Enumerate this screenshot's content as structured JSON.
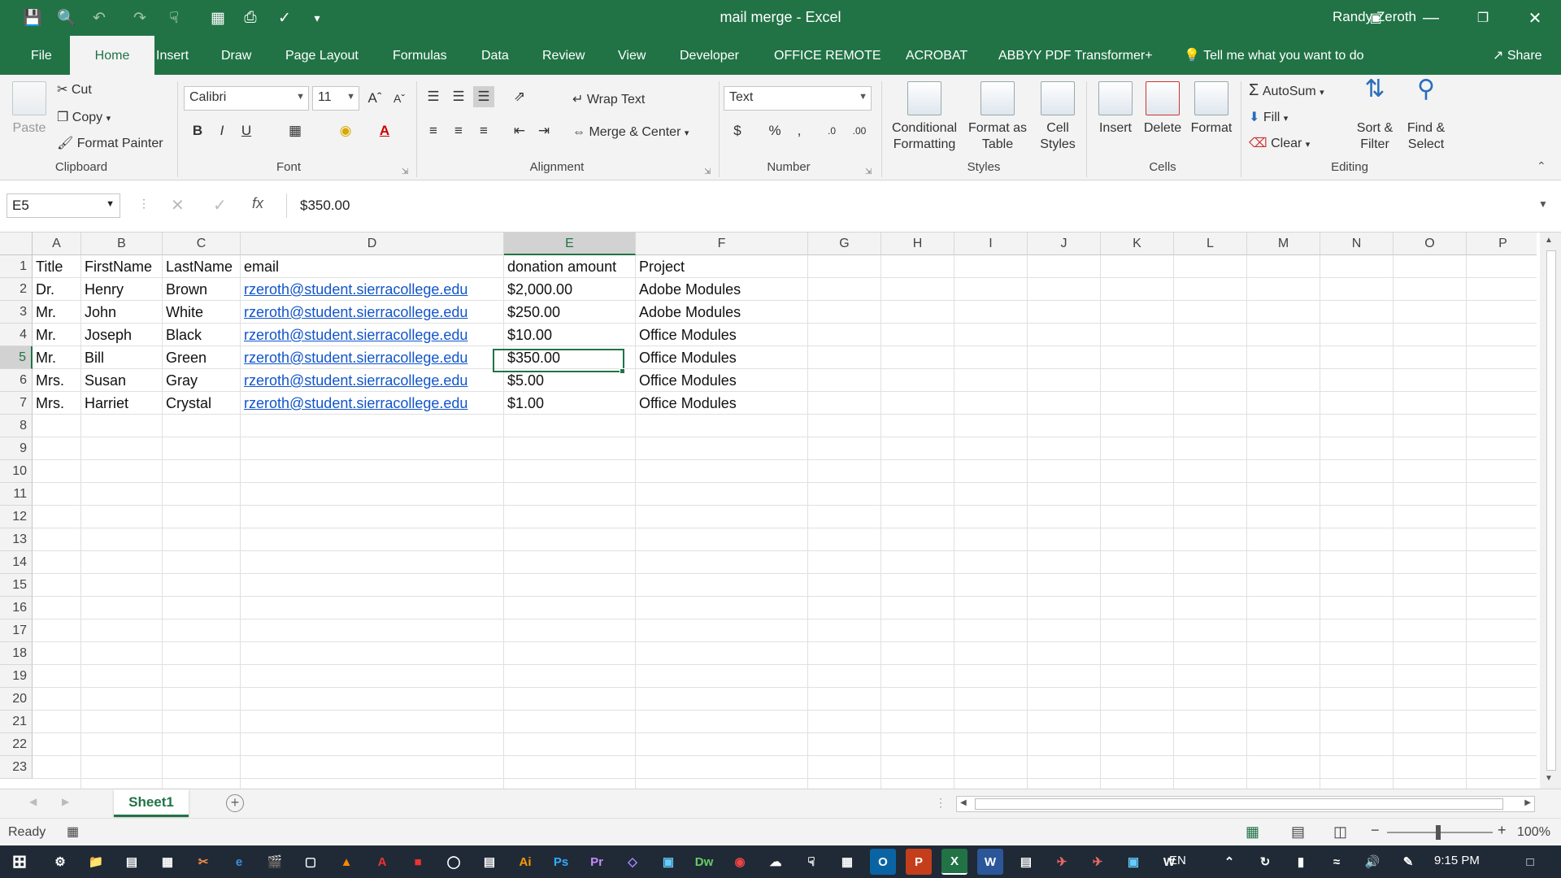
{
  "window": {
    "title": "mail merge  -  Excel",
    "user": "Randy Zeroth"
  },
  "tabs": [
    "File",
    "Home",
    "Insert",
    "Draw",
    "Page Layout",
    "Formulas",
    "Data",
    "Review",
    "View",
    "Developer",
    "OFFICE REMOTE",
    "ACROBAT",
    "ABBYY PDF Transformer+"
  ],
  "active_tab": "Home",
  "tell_me": "Tell me what you want to do",
  "share": "Share",
  "clipboard": {
    "paste": "Paste",
    "cut": "Cut",
    "copy": "Copy",
    "format_painter": "Format Painter",
    "label": "Clipboard"
  },
  "font": {
    "name": "Calibri",
    "size": "11",
    "bold": "B",
    "italic": "I",
    "underline": "U",
    "label": "Font"
  },
  "alignment": {
    "wrap_text": "Wrap Text",
    "merge_center": "Merge & Center",
    "label": "Alignment"
  },
  "number": {
    "format": "Text",
    "currency": "$",
    "percent": "%",
    "comma": ",",
    "label": "Number"
  },
  "styles": {
    "conditional": "Conditional",
    "conditional2": "Formatting",
    "format_as": "Format as",
    "table": "Table",
    "cell": "Cell",
    "styles": "Styles",
    "label": "Styles"
  },
  "cells": {
    "insert": "Insert",
    "delete": "Delete",
    "format": "Format",
    "label": "Cells"
  },
  "editing": {
    "autosum": "AutoSum",
    "fill": "Fill",
    "clear": "Clear",
    "sort": "Sort &",
    "filter": "Filter",
    "find": "Find &",
    "select": "Select",
    "label": "Editing"
  },
  "formula_bar": {
    "name_box": "E5",
    "fx": "fx",
    "content": "$350.00"
  },
  "columns": [
    "A",
    "B",
    "C",
    "D",
    "E",
    "F",
    "G",
    "H",
    "I",
    "J",
    "K",
    "L",
    "M",
    "N",
    "O",
    "P"
  ],
  "selected_column": "E",
  "selected_row": 5,
  "row_numbers": [
    "1",
    "2",
    "3",
    "4",
    "5",
    "6",
    "7",
    "8",
    "9",
    "10",
    "11",
    "12",
    "13",
    "14",
    "15",
    "16",
    "17",
    "18",
    "19",
    "20",
    "21",
    "22",
    "23"
  ],
  "table": {
    "headers": [
      "Title",
      "FirstName",
      "LastName",
      "email",
      "donation amount",
      "Project"
    ],
    "rows": [
      [
        "Dr.",
        "Henry",
        "Brown",
        "rzeroth@student.sierracollege.edu",
        "$2,000.00",
        "Adobe Modules"
      ],
      [
        "Mr.",
        "John",
        "White",
        "rzeroth@student.sierracollege.edu",
        "$250.00",
        "Adobe Modules"
      ],
      [
        "Mr.",
        "Joseph",
        "Black",
        "rzeroth@student.sierracollege.edu",
        "$10.00",
        "Office Modules"
      ],
      [
        "Mr.",
        "Bill",
        "Green",
        "rzeroth@student.sierracollege.edu",
        "$350.00",
        "Office Modules"
      ],
      [
        "Mrs.",
        "Susan",
        "Gray",
        "rzeroth@student.sierracollege.edu",
        "$5.00",
        "Office Modules"
      ],
      [
        "Mrs.",
        "Harriet",
        "Crystal",
        "rzeroth@student.sierracollege.edu",
        "$1.00",
        "Office Modules"
      ]
    ]
  },
  "sheets": [
    "Sheet1"
  ],
  "status": {
    "ready": "Ready",
    "zoom": "100%"
  },
  "taskbar": {
    "lang": "EN",
    "time": "9:15 PM"
  },
  "colors": {
    "accent": "#217346",
    "link": "#1155cc"
  }
}
